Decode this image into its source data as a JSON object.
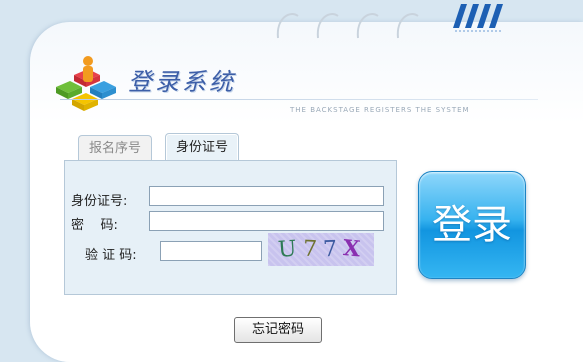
{
  "app": {
    "title": "登录系统",
    "subtitle": "THE BACKSTAGE REGISTERS THE SYSTEM"
  },
  "tabs": [
    {
      "label": "报名序号",
      "active": false
    },
    {
      "label": "身份证号",
      "active": true
    }
  ],
  "form": {
    "id_label": "身份证号:",
    "id_value": "",
    "password_label": "密    码:",
    "password_value": "",
    "captcha_label": "验 证 码:",
    "captcha_value": "",
    "captcha_chars": [
      "U",
      "7",
      "7",
      "X"
    ],
    "captcha_colors": [
      "#2e7a55",
      "#6e7230",
      "#3c5aa0",
      "#8a2fb0"
    ]
  },
  "buttons": {
    "login": "登录",
    "forgot": "忘记密码"
  },
  "colors": {
    "background": "#d7e6f1",
    "accent_blue": "#1295e0",
    "title_blue": "#3d5fa8"
  }
}
